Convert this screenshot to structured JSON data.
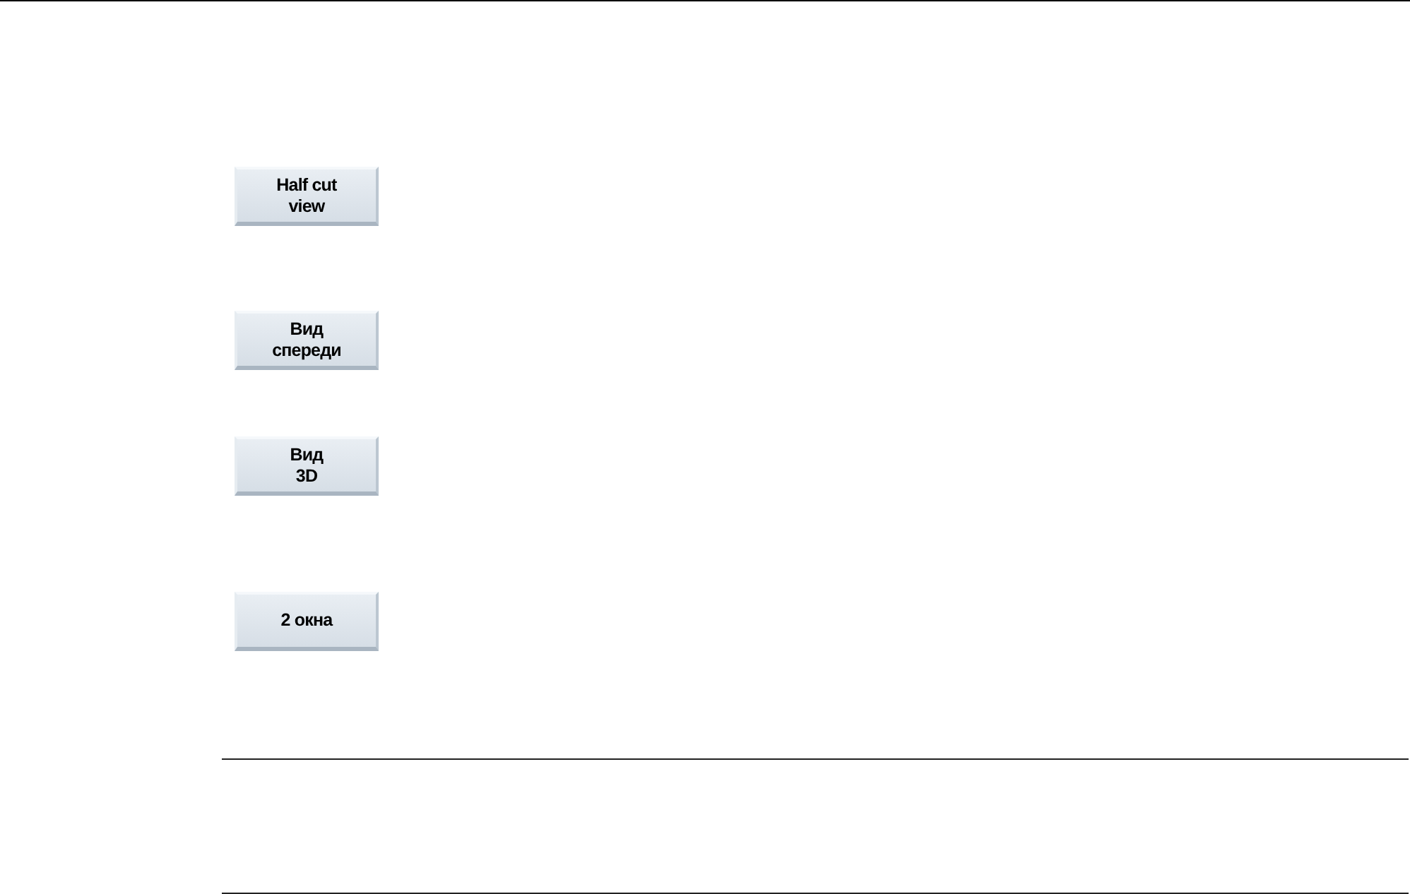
{
  "softkeys": [
    {
      "label": "Half cut\nview"
    },
    {
      "label": "Вид\nспереди"
    },
    {
      "label": "Вид\n3D"
    },
    {
      "label": "2 окна"
    }
  ]
}
